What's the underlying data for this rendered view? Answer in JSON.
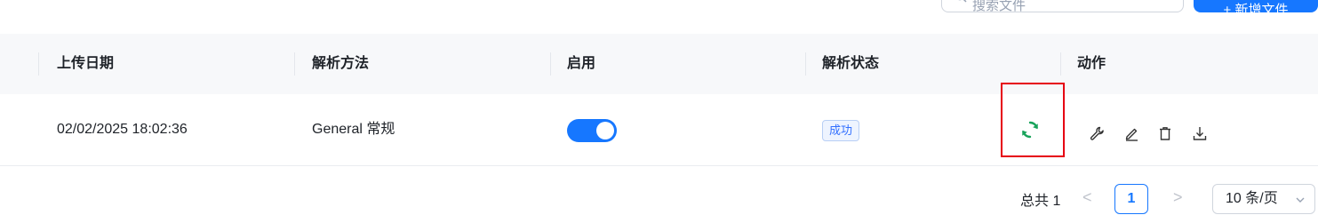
{
  "toolbar": {
    "search_placeholder": "搜索文件",
    "add_label": "+ 新增文件"
  },
  "table": {
    "columns": [
      "上传日期",
      "解析方法",
      "启用",
      "解析状态",
      "动作"
    ],
    "rows": [
      {
        "upload_date": "02/02/2025 18:02:36",
        "parse_method": "General 常规",
        "enabled": true,
        "status": "成功"
      }
    ]
  },
  "actions": {
    "refresh_icon": "refresh-icon",
    "items": [
      "wrench-icon",
      "edit-icon",
      "trash-icon",
      "download-icon"
    ]
  },
  "pagination": {
    "total_label": "总共 1",
    "current_page": "1",
    "page_size": "10 条/页"
  },
  "colors": {
    "accent": "#1677ff",
    "success_icon": "#19a35b",
    "highlight": "#e60012"
  }
}
